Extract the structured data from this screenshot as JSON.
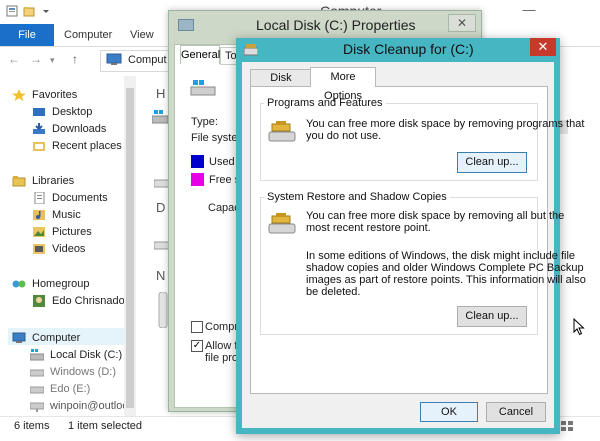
{
  "explorer": {
    "title": "Computer",
    "quick_access_icons": [
      "properties-icon",
      "new-folder-icon",
      "dropdown-icon"
    ],
    "ribbon_tabs": [
      "File",
      "Computer",
      "View"
    ],
    "address": "Comput",
    "nav": {
      "favorites": "Favorites",
      "desktop": "Desktop",
      "downloads": "Downloads",
      "recent": "Recent places",
      "libraries": "Libraries",
      "documents": "Documents",
      "music": "Music",
      "pictures": "Pictures",
      "videos": "Videos",
      "homegroup": "Homegroup",
      "user": "Edo Chrisnado",
      "computer": "Computer",
      "local_disk": "Local Disk (C:)",
      "windows_d": "Windows (D:)",
      "edo_e": "Edo (E:)",
      "winpoin": "winpoin@outloo"
    },
    "content_letters": [
      "H",
      "D",
      "N"
    ],
    "status_items": "6 items",
    "status_selected": "1 item selected"
  },
  "properties": {
    "title": "Local Disk (C:) Properties",
    "tabs": [
      "General",
      "To"
    ],
    "type_label": "Type:",
    "fs_label": "File system:",
    "used_label": "Used s",
    "free_label": "Free sp",
    "capacity_label": "Capaci",
    "compress_label": "Compres",
    "allow_label_1": "Allow file",
    "allow_label_2": "file prope",
    "used_color": "#0000cc",
    "free_color": "#e600e6"
  },
  "cleanup": {
    "title": "Disk Cleanup for  (C:)",
    "tabs": [
      "Disk Cleanup",
      "More Options"
    ],
    "programs": {
      "title": "Programs and Features",
      "text_1": "You can free more disk space by removing programs that",
      "text_2": "you do not use.",
      "button": "Clean up..."
    },
    "restore": {
      "title": "System Restore and Shadow Copies",
      "text_1": "You can free more disk space by removing all but the",
      "text_2": "most recent restore point.",
      "note_1": "In some editions of Windows, the disk might include file",
      "note_2": "shadow copies and older Windows Complete PC Backup",
      "note_3": "images as part of restore points. This information will also",
      "note_4": "be deleted.",
      "button": "Clean up..."
    },
    "ok": "OK",
    "cancel": "Cancel",
    "title_color": "#47b6c3",
    "close_color": "#c7392b"
  }
}
